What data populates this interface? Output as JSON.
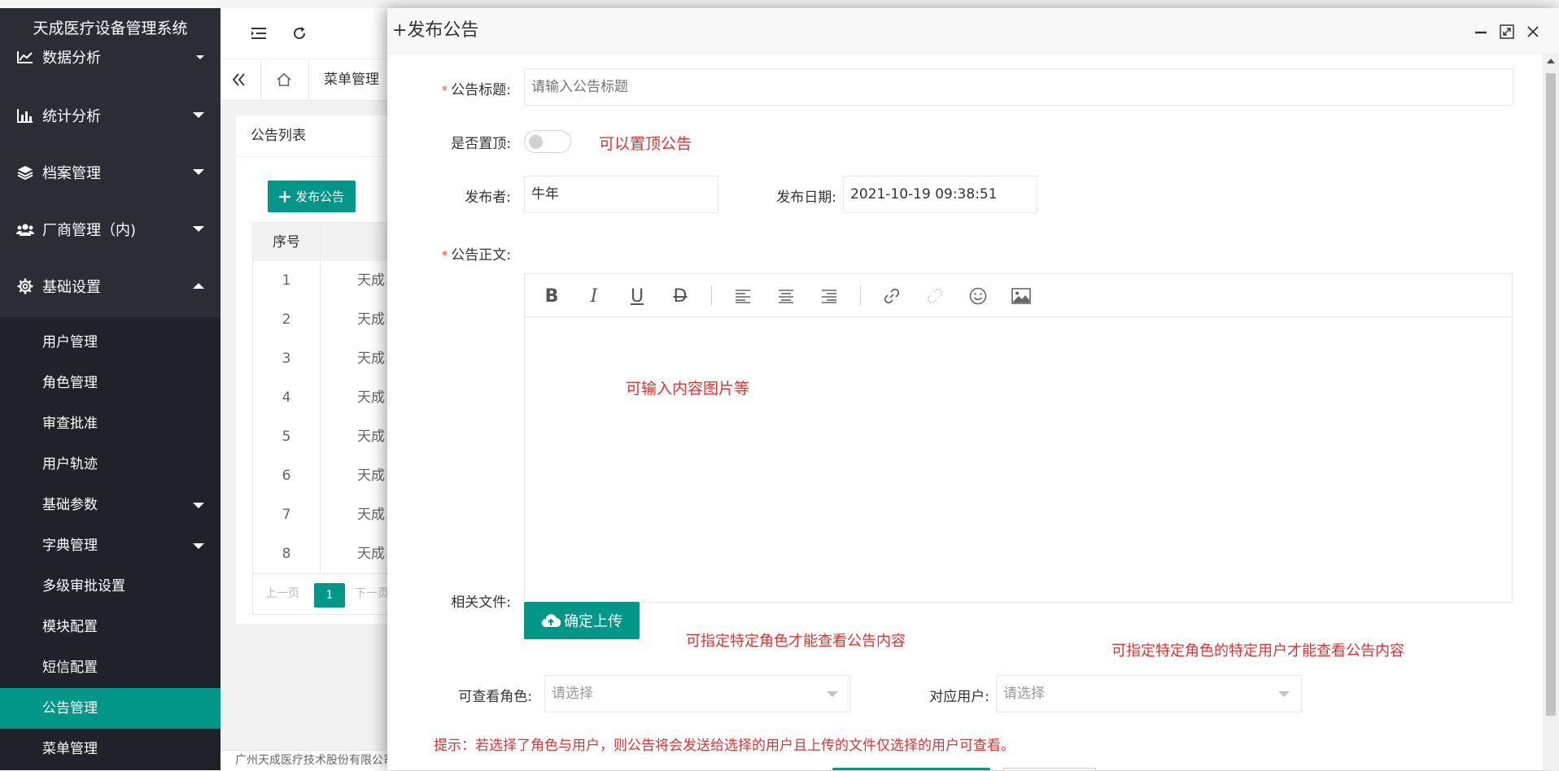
{
  "app": {
    "title": "天成医疗设备管理系统"
  },
  "sidebar": {
    "top_items": [
      {
        "label": "数据分析",
        "icon": "line-chart-icon"
      },
      {
        "label": "统计分析",
        "icon": "bar-chart-icon"
      },
      {
        "label": "档案管理",
        "icon": "layers-icon"
      },
      {
        "label": "厂商管理（内)",
        "icon": "users-icon"
      },
      {
        "label": "基础设置",
        "icon": "gear-icon"
      }
    ],
    "sub_items": [
      {
        "label": "用户管理"
      },
      {
        "label": "角色管理"
      },
      {
        "label": "审查批准"
      },
      {
        "label": "用户轨迹"
      },
      {
        "label": "基础参数"
      },
      {
        "label": "字典管理"
      },
      {
        "label": "多级审批设置"
      },
      {
        "label": "模块配置"
      },
      {
        "label": "短信配置"
      },
      {
        "label": "公告管理"
      },
      {
        "label": "菜单管理"
      }
    ],
    "active": "公告管理",
    "accent": "#009688"
  },
  "tabs": {
    "current": "菜单管理"
  },
  "list": {
    "title": "公告列表",
    "publish_button": "发布公告",
    "col_index": "序号",
    "rows": [
      {
        "index": "1",
        "text": "天成"
      },
      {
        "index": "2",
        "text": "天成"
      },
      {
        "index": "3",
        "text": "天成"
      },
      {
        "index": "4",
        "text": "天成"
      },
      {
        "index": "5",
        "text": "天成"
      },
      {
        "index": "6",
        "text": "天成"
      },
      {
        "index": "7",
        "text": "天成"
      },
      {
        "index": "8",
        "text": "天成"
      }
    ],
    "pager": {
      "prev": "上一页",
      "page": "1",
      "next": "下一页"
    }
  },
  "footer": {
    "text": "广州天成医疗技术股份有限公司"
  },
  "modal": {
    "title": "+发布公告",
    "form": {
      "title_label": "公告标题:",
      "title_placeholder": "请输入公告标题",
      "pin_label": "是否置顶:",
      "pin_note": "可以置顶公告",
      "publisher_label": "发布者:",
      "publisher_value": "牛年",
      "date_label": "发布日期:",
      "date_value": "2021-10-19 09:38:51",
      "body_label": "公告正文:",
      "body_note": "可输入内容图片等",
      "files_label": "相关文件:",
      "upload_button": "确定上传",
      "role_note": "可指定特定角色才能查看公告内容",
      "user_note": "可指定特定角色的特定用户才能查看公告内容",
      "roles_label": "可查看角色:",
      "roles_placeholder": "请选择",
      "users_label": "对应用户:",
      "users_placeholder": "请选择",
      "tip": "提示：若选择了角色与用户，则公告将会发送给选择的用户且上传的文件仅选择的用户可查看。"
    }
  }
}
